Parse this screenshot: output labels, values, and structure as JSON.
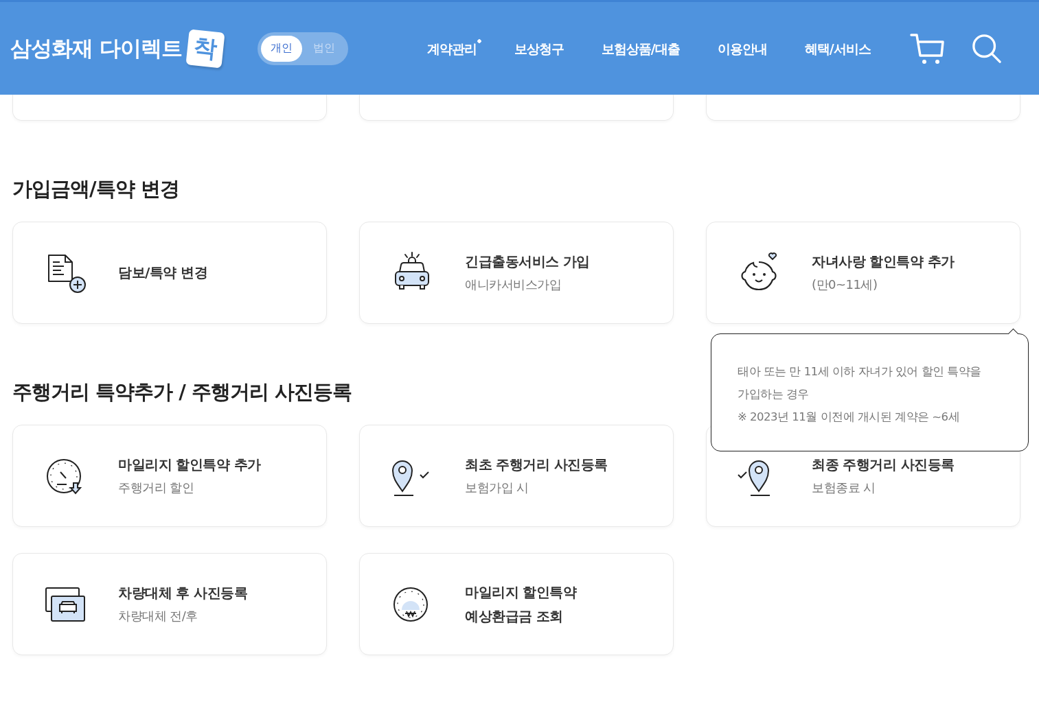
{
  "header": {
    "logo": "삼성화재 다이렉트",
    "logo_badge": "착",
    "toggle": [
      {
        "label": "개인",
        "selected": true
      },
      {
        "label": "법인",
        "selected": false
      }
    ],
    "nav": [
      {
        "label": "계약관리",
        "dot": true
      },
      {
        "label": "보상청구",
        "dot": false
      },
      {
        "label": "보험상품/대출",
        "dot": false
      },
      {
        "label": "이용안내",
        "dot": false
      },
      {
        "label": "혜택/서비스",
        "dot": false
      }
    ]
  },
  "sections": [
    {
      "title": "가입금액/특약 변경",
      "cards": [
        {
          "title": [
            "담보/특약 변경"
          ]
        },
        {
          "title": [
            "긴급출동서비스 가입"
          ],
          "subtitle": "애니카서비스가입"
        },
        {
          "title": [
            "자녀사랑 할인특약 추가"
          ],
          "subtitle": "(만0~11세)",
          "tooltip": [
            "태아 또는 만 11세 이하 자녀가 있어 할인 특약을 가입하는 경우",
            "※ 2023년 11월 이전에 개시된 계약은 ~6세"
          ]
        }
      ]
    },
    {
      "title": "주행거리 특약추가 / 주행거리 사진등록",
      "cards": [
        {
          "title": [
            "마일리지 할인특약 추가"
          ],
          "subtitle": "주행거리 할인"
        },
        {
          "title": [
            "최초 주행거리 사진등록"
          ],
          "subtitle": "보험가입 시"
        },
        {
          "title": [
            "최종 주행거리 사진등록"
          ],
          "subtitle": "보험종료 시"
        },
        {
          "title": [
            "차량대체 후 사진등록"
          ],
          "subtitle": "차량대체 전/후"
        },
        {
          "title": [
            "마일리지 할인특약",
            "예상환급금 조회"
          ]
        }
      ]
    }
  ]
}
